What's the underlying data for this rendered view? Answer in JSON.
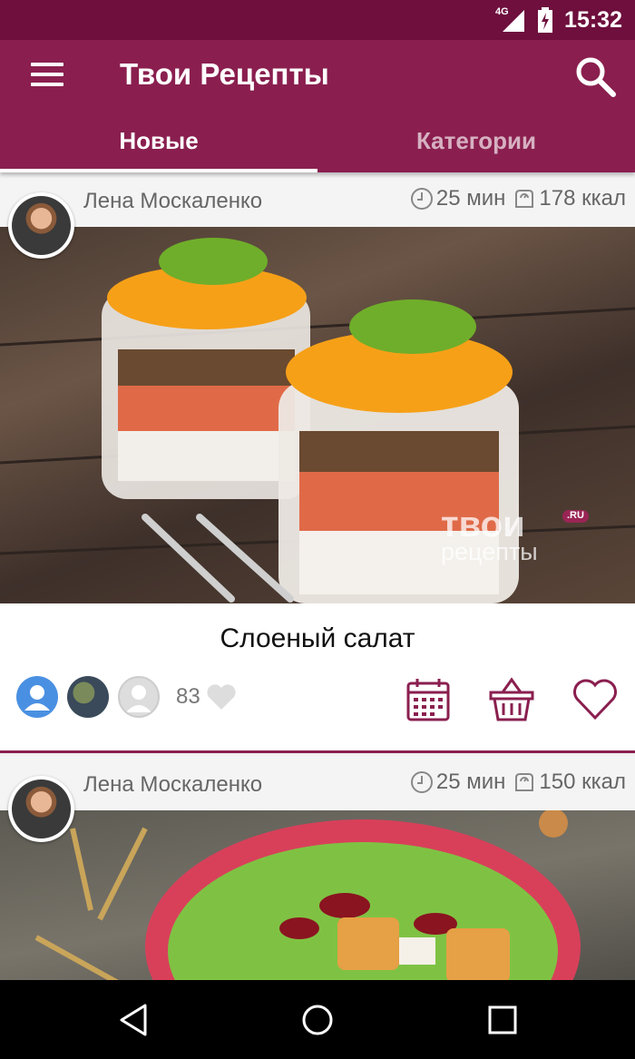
{
  "status_bar": {
    "network": "4G",
    "time": "15:32"
  },
  "app_bar": {
    "title": "Твои Рецепты"
  },
  "tabs": [
    {
      "label": "Новые",
      "active": true
    },
    {
      "label": "Категории",
      "active": false
    }
  ],
  "colors": {
    "status_bar": "#6e0f3d",
    "primary": "#8a1f4f",
    "icon_accent": "#8a1f4f"
  },
  "recipes": [
    {
      "author": "Лена Москаленко",
      "time": "25 мин",
      "calories": "178 ккал",
      "title": "Слоеный салат",
      "likes": "83",
      "watermark": {
        "line1": "твои",
        "line2": "рецепты",
        "tag": ".RU"
      }
    },
    {
      "author": "Лена Москаленко",
      "time": "25 мин",
      "calories": "150 ккал"
    }
  ],
  "icons": [
    "menu-icon",
    "search-icon",
    "clock-icon",
    "scale-icon",
    "heart-icon",
    "calendar-icon",
    "basket-icon",
    "back-icon",
    "home-icon",
    "recent-apps-icon"
  ]
}
